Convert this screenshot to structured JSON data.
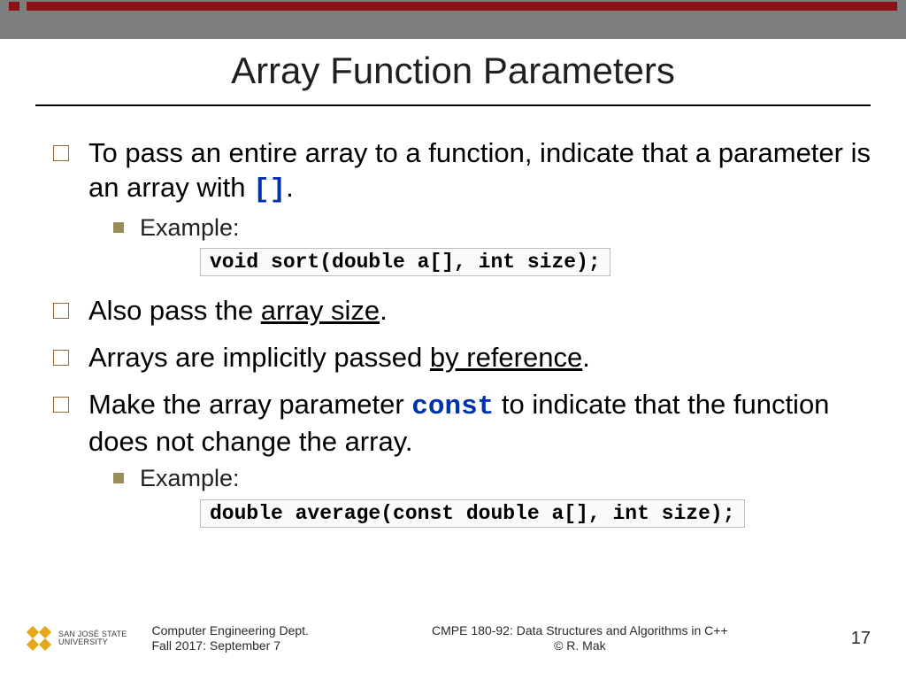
{
  "title": "Array Function Parameters",
  "bullets": {
    "b1_pre": "To pass an entire array to a function, indicate that a parameter is an array with ",
    "b1_code": "[]",
    "b1_post": ".",
    "ex_label": "Example:",
    "code1": "void sort(double a[], int size);",
    "b2_pre": "Also pass the ",
    "b2_ul": "array size",
    "b2_post": ".",
    "b3_pre": "Arrays are implicitly passed ",
    "b3_ul": "by reference",
    "b3_post": ".",
    "b4_pre": "Make the array parameter ",
    "b4_code": "const",
    "b4_post": " to indicate that the function does not change the array.",
    "code2": "double average(const double a[], int size);"
  },
  "footer": {
    "logo_line1": "SAN JOSÉ STATE",
    "logo_line2": "UNIVERSITY",
    "dept": "Computer Engineering Dept.",
    "date": "Fall 2017: September 7",
    "course": "CMPE 180-92: Data Structures and Algorithms in C++",
    "copyright": "© R. Mak",
    "page": "17"
  }
}
